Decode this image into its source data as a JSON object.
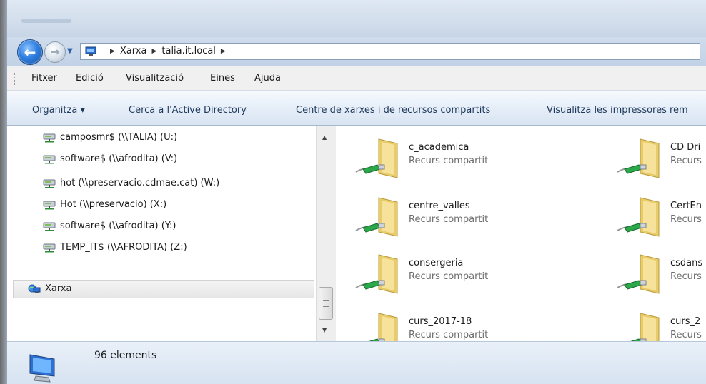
{
  "window": {
    "accent": "#2f7fe0",
    "chrome": "#c9d6e6"
  },
  "nav": {
    "back_icon": "back-arrow-icon",
    "forward_icon": "forward-arrow-icon",
    "breadcrumbs": [
      "Xarxa",
      "talia.it.local"
    ]
  },
  "menu": [
    "Fitxer",
    "Edició",
    "Visualització",
    "Eines",
    "Ajuda"
  ],
  "commands": {
    "organize": "Organitza ▾",
    "search_ad": "Cerca a l'Active Directory",
    "network_center": "Centre de xarxes i de recursos compartits",
    "printers": "Visualitza les impressores rem"
  },
  "tree": {
    "drives": [
      "camposmr$ (\\\\TALIA) (U:)",
      "software$ (\\\\afrodita) (V:)",
      "hot (\\\\preservacio.cdmae.cat) (W:)",
      "Hot (\\\\preservacio) (X:)",
      "software$ (\\\\afrodita) (Y:)",
      "TEMP_IT$ (\\\\AFRODITA) (Z:)"
    ],
    "network_label": "Xarxa"
  },
  "shares": {
    "left": [
      {
        "name": "c_academica",
        "type": "Recurs compartit"
      },
      {
        "name": "centre_valles",
        "type": "Recurs compartit"
      },
      {
        "name": "consergeria",
        "type": "Recurs compartit"
      },
      {
        "name": "curs_2017-18",
        "type": "Recurs compartit"
      }
    ],
    "right": [
      {
        "name": "CD Dri",
        "type": "Recurs"
      },
      {
        "name": "CertEn",
        "type": "Recurs"
      },
      {
        "name": "csdans",
        "type": "Recurs"
      },
      {
        "name": "curs_2",
        "type": "Recurs"
      }
    ]
  },
  "status": {
    "count": "96 elements"
  }
}
